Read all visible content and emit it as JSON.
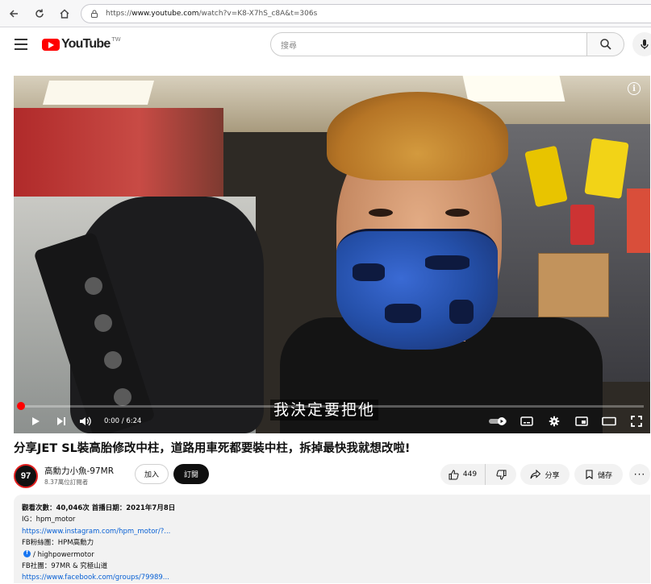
{
  "browser": {
    "url_prefix": "https://",
    "url_domain": "www.youtube.com",
    "url_rest": "/watch?v=K8-X7hS_c8A&t=306s"
  },
  "header": {
    "logo_text": "YouTube",
    "logo_sup": "TW",
    "search_placeholder": "搜尋"
  },
  "player": {
    "subtitle": "我決定要把他",
    "time_display": "0:00 / 6:24",
    "progress_fraction": 0.0,
    "accent_color": "#ff0000"
  },
  "video": {
    "title": "分享JET SL裝高胎修改中柱，道路用車死都要裝中柱，拆掉最快我就想改啦!"
  },
  "channel": {
    "avatar_text": "97",
    "name": "高勳力小魚-97MR",
    "subscribers": "8.37萬位訂閱者",
    "join_label": "加入",
    "subscribe_label": "訂閱"
  },
  "actions": {
    "like_count": "449",
    "share_label": "分享",
    "save_label": "儲存",
    "more_label": "···"
  },
  "description": {
    "stats": "觀看次數：40,046次  首播日期：2021年7月8日",
    "ig_label": "IG：hpm_motor",
    "ig_link": "https://www.instagram.com/hpm_motor/?...",
    "fb_fans_label": "FB粉絲團：HPM高勳力",
    "fb_handle": "/ highpowermotor",
    "fb_group_label": "FB社團：97MR & 究極山道",
    "fb_group_link": "https://www.facebook.com/groups/79989..."
  }
}
